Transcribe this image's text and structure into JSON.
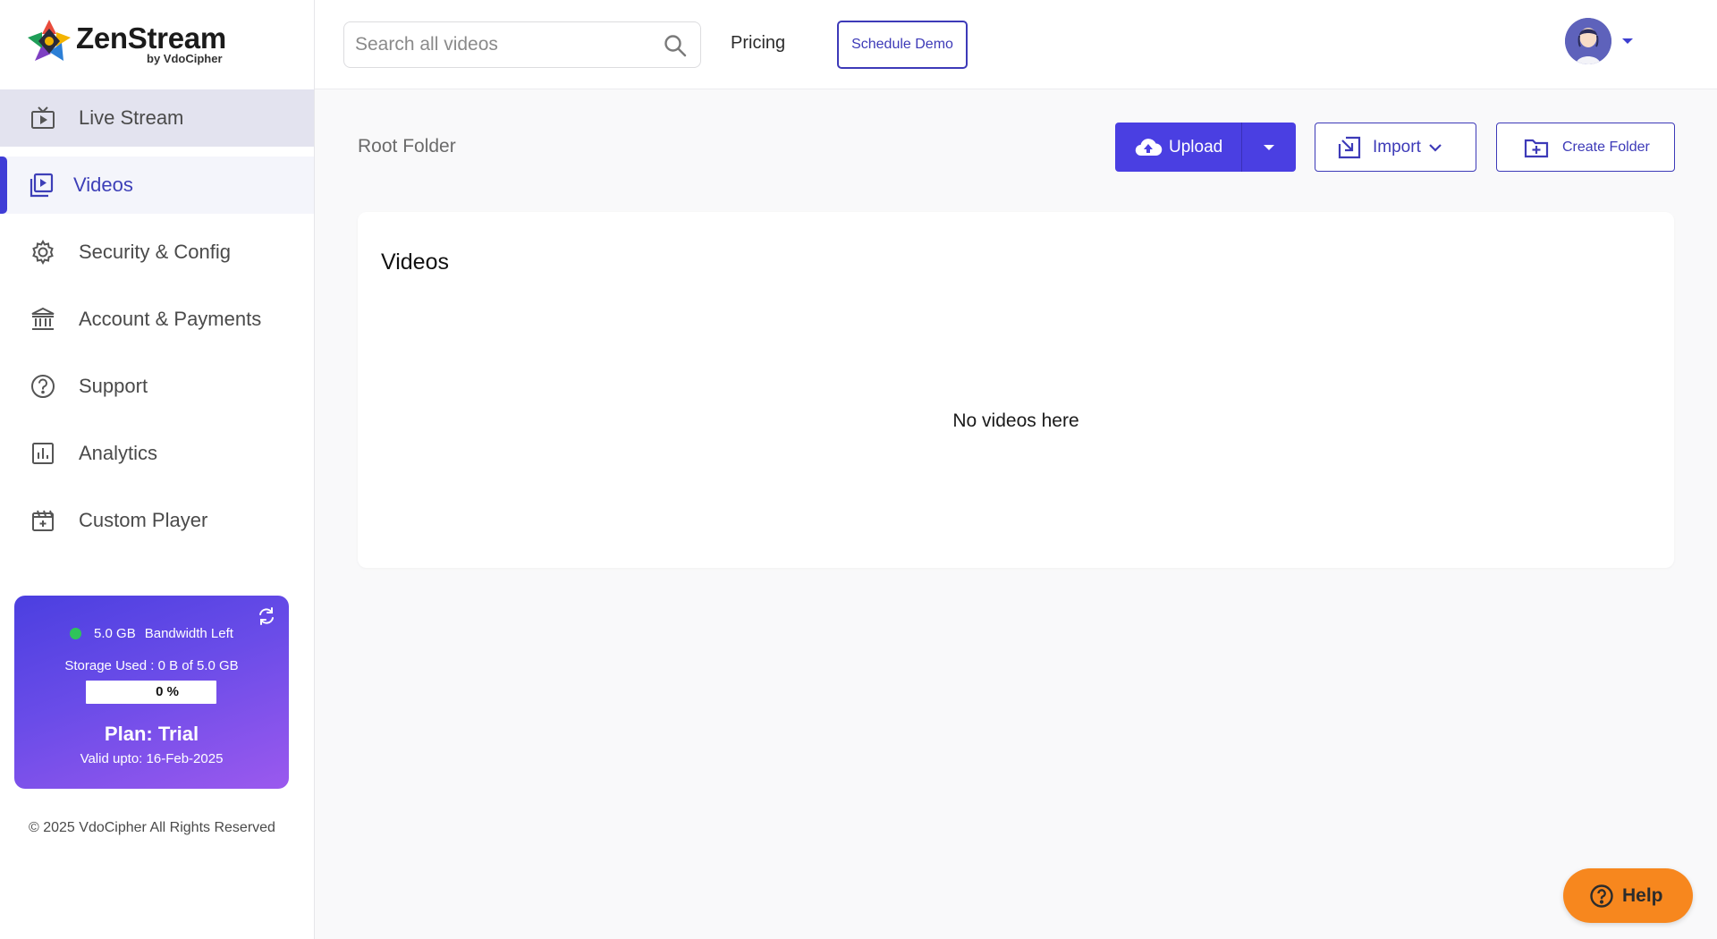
{
  "brand": {
    "name": "ZenStream",
    "byline": "by VdoCipher"
  },
  "sidebar": {
    "items": [
      {
        "label": "Live Stream",
        "icon": "live-tv-icon"
      },
      {
        "label": "Videos",
        "icon": "video-library-icon"
      },
      {
        "label": "Security & Config",
        "icon": "gear-icon"
      },
      {
        "label": "Account & Payments",
        "icon": "bank-icon"
      },
      {
        "label": "Support",
        "icon": "question-circle-icon"
      },
      {
        "label": "Analytics",
        "icon": "analytics-chart-icon"
      },
      {
        "label": "Custom Player",
        "icon": "movie-player-icon"
      }
    ],
    "active": "Videos"
  },
  "plan": {
    "bandwidth_value": "5.0 GB",
    "bandwidth_label": "Bandwidth Left",
    "storage_text": "Storage Used : 0 B of 5.0 GB",
    "progress_text": "0 %",
    "progress_fraction": 0,
    "plan_name": "Plan: Trial",
    "valid_text": "Valid upto: 16-Feb-2025"
  },
  "footer": {
    "copyright": "© 2025 VdoCipher All Rights Reserved"
  },
  "header": {
    "search_placeholder": "Search all videos",
    "pricing_label": "Pricing",
    "schedule_demo_label": "Schedule Demo"
  },
  "main": {
    "folder_label": "Root Folder",
    "upload_label": "Upload",
    "import_label": "Import",
    "create_folder_label": "Create Folder",
    "card_title": "Videos",
    "empty_message": "No videos here"
  },
  "help": {
    "label": "Help"
  },
  "colors": {
    "accent": "#4a3fe2",
    "accent_text": "#3d3ab8",
    "help_orange": "#f7871e",
    "status_green": "#2fc35a"
  }
}
